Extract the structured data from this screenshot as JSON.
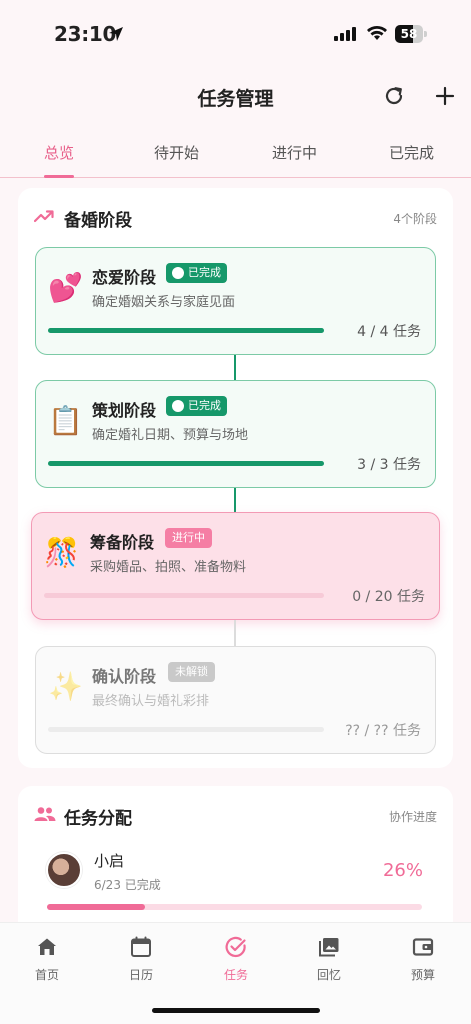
{
  "status": {
    "time": "23:10",
    "battery": "58"
  },
  "header": {
    "title": "任务管理"
  },
  "tabs": [
    "总览",
    "待开始",
    "进行中",
    "已完成"
  ],
  "stages_card": {
    "title": "备婚阶段",
    "meta": "4个阶段",
    "stages": [
      {
        "emoji": "💕",
        "name": "恋爱阶段",
        "badge": "已完成",
        "desc": "确定婚姻关系与家庭见面",
        "count": "4 / 4 任务",
        "progress": 1.0
      },
      {
        "emoji": "📋",
        "name": "策划阶段",
        "badge": "已完成",
        "desc": "确定婚礼日期、预算与场地",
        "count": "3 / 3 任务",
        "progress": 1.0
      },
      {
        "emoji": "🎊",
        "name": "筹备阶段",
        "badge": "进行中",
        "desc": "采购婚品、拍照、准备物料",
        "count": "0 / 20 任务",
        "progress": 0.0
      },
      {
        "emoji": "✨",
        "name": "确认阶段",
        "badge": "未解锁",
        "desc": "最终确认与婚礼彩排",
        "count": "?? / ?? 任务",
        "progress": 0.0
      }
    ]
  },
  "assign_card": {
    "title": "任务分配",
    "meta": "协作进度",
    "member": {
      "name": "小启",
      "sub": "6/23 已完成",
      "pct": "26%",
      "progress": 0.26
    }
  },
  "nav": [
    "首页",
    "日历",
    "任务",
    "回忆",
    "预算"
  ],
  "colors": {
    "accent": "#f06b97",
    "done": "#16986a"
  }
}
